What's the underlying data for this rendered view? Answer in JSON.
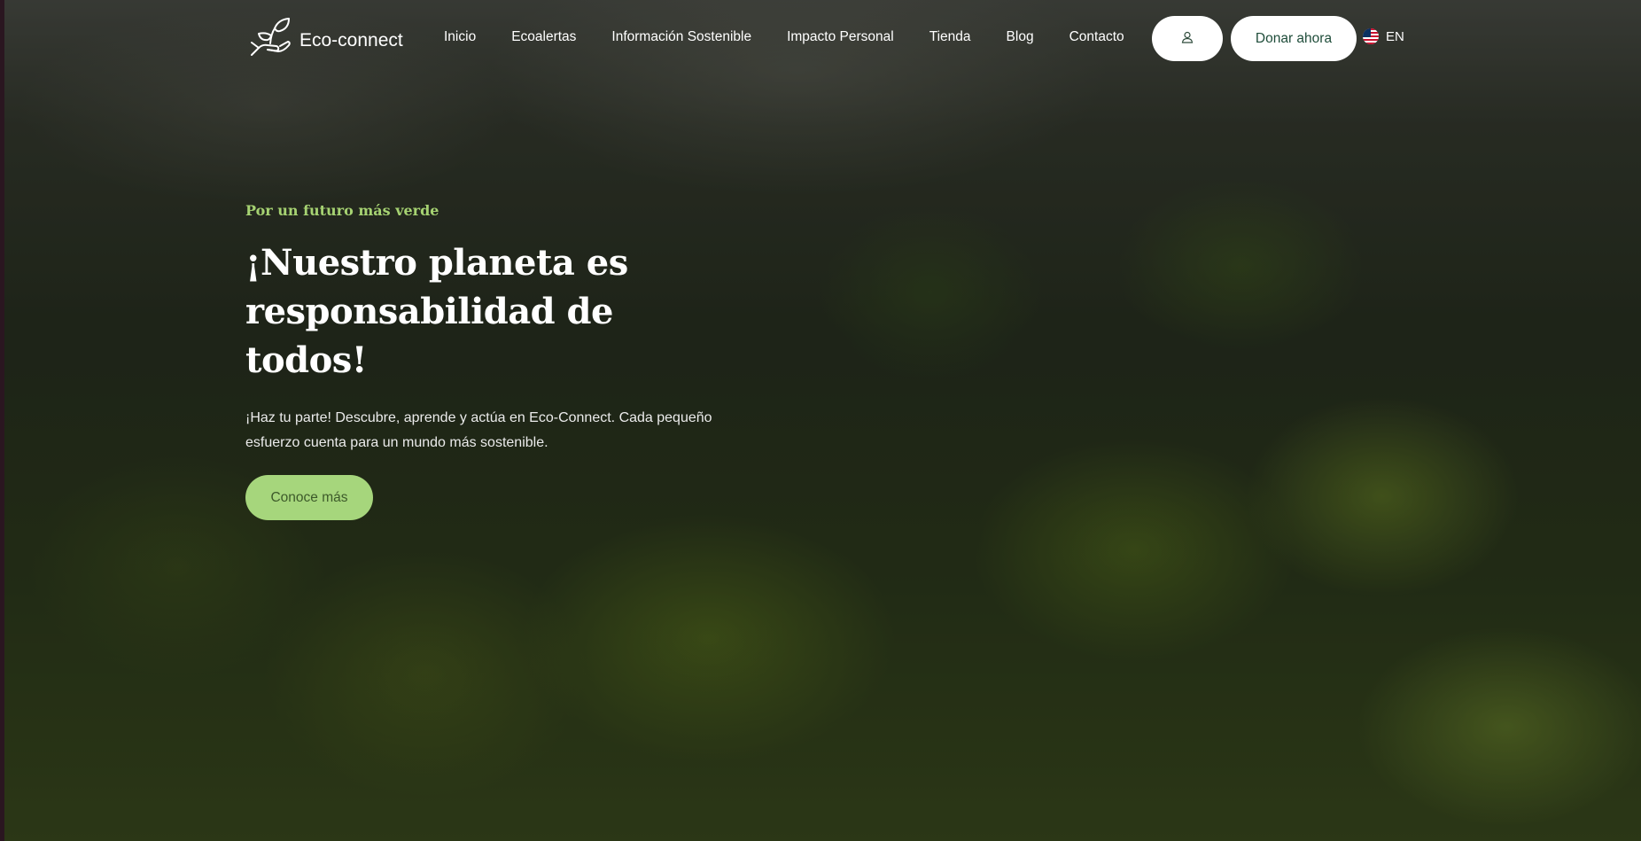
{
  "header": {
    "logo_text": "Eco-connect",
    "nav": [
      {
        "label": "Inicio"
      },
      {
        "label": "Ecoalertas"
      },
      {
        "label": "Información Sostenible"
      },
      {
        "label": "Impacto Personal"
      },
      {
        "label": "Tienda"
      },
      {
        "label": "Blog"
      },
      {
        "label": "Contacto"
      }
    ],
    "user_button_icon": "user-icon",
    "donate_label": "Donar ahora",
    "language": {
      "code": "EN",
      "flag_icon": "us-flag-icon"
    }
  },
  "hero": {
    "tagline": "Por un futuro más verde",
    "headline_line1": "¡Nuestro planeta es",
    "headline_line2": "responsabilidad de todos!",
    "description": "¡Haz tu parte! Descubre, aprende y actúa en Eco-Connect. Cada pequeño esfuerzo cuenta para un mundo más sostenible.",
    "cta_label": "Conoce más"
  },
  "colors": {
    "accent_green": "#a6d67c",
    "tagline_green": "#a6d272",
    "donate_text": "#1f4d3a"
  }
}
